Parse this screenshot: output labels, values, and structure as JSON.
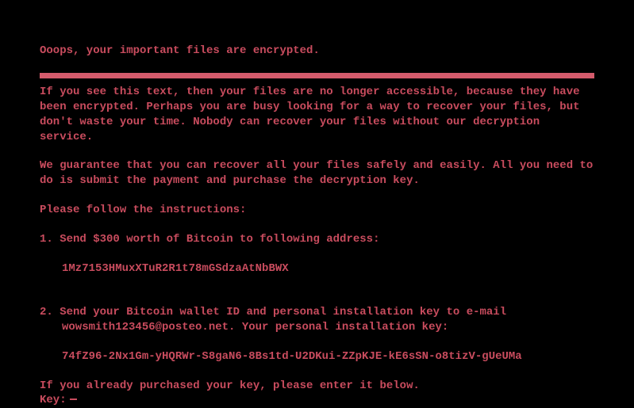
{
  "header": "Ooops, your important files are encrypted.",
  "para1": "If you see this text, then your files are no longer accessible, because they have been encrypted.  Perhaps you are busy looking for a way to recover your files, but don't waste your time.  Nobody can recover your files without our decryption service.",
  "para2": "We guarantee that you can recover all your files safely and easily.  All you need to do is submit the payment and purchase the decryption key.",
  "instructions_label": "Please follow the instructions:",
  "step1": "1. Send $300 worth of Bitcoin to following address:",
  "btc_address": "1Mz7153HMuxXTuR2R1t78mGSdzaAtNbBWX",
  "step2_line1": "2. Send your Bitcoin wallet ID and personal installation key to e-mail",
  "step2_line2": "wowsmith123456@posteo.net. Your personal installation key:",
  "install_key": "74fZ96-2Nx1Gm-yHQRWr-S8gaN6-8Bs1td-U2DKui-ZZpKJE-kE6sSN-o8tizV-gUeUMa",
  "already_purchased": "If you already purchased your key, please enter it below.",
  "key_label": "Key: "
}
